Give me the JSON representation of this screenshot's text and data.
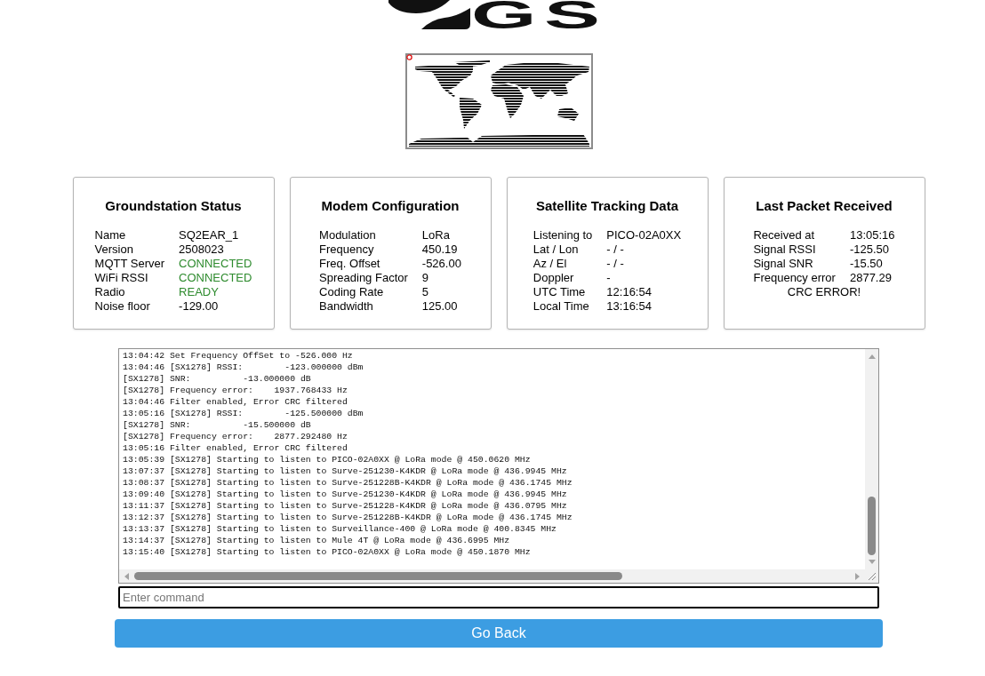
{
  "logo": {
    "text": "GS"
  },
  "cards": [
    {
      "title": "Groundstation Status",
      "rows": [
        {
          "label": "Name",
          "value": "SQ2EAR_1",
          "kind": "plain"
        },
        {
          "label": "Version",
          "value": "2508023",
          "kind": "plain"
        },
        {
          "label": "MQTT Server",
          "value": "CONNECTED",
          "kind": "status"
        },
        {
          "label": "WiFi RSSI",
          "value": "CONNECTED",
          "kind": "status"
        },
        {
          "label": "Radio",
          "value": "READY",
          "kind": "status"
        },
        {
          "label": "Noise floor",
          "value": "-129.00",
          "kind": "plain"
        }
      ]
    },
    {
      "title": "Modem Configuration",
      "rows": [
        {
          "label": "Modulation",
          "value": "LoRa",
          "kind": "plain"
        },
        {
          "label": "Frequency",
          "value": "450.19",
          "kind": "plain"
        },
        {
          "label": "Freq. Offset",
          "value": "-526.00",
          "kind": "plain"
        },
        {
          "label": "Spreading Factor",
          "value": "9",
          "kind": "plain"
        },
        {
          "label": "Coding Rate",
          "value": "5",
          "kind": "plain"
        },
        {
          "label": "Bandwidth",
          "value": "125.00",
          "kind": "plain"
        }
      ]
    },
    {
      "title": "Satellite Tracking Data",
      "rows": [
        {
          "label": "Listening to",
          "value": "PICO-02A0XX",
          "kind": "plain"
        },
        {
          "label": "Lat / Lon",
          "value": "- / -",
          "kind": "plain"
        },
        {
          "label": "Az / El",
          "value": "- / -",
          "kind": "plain"
        },
        {
          "label": "Doppler",
          "value": "-",
          "kind": "plain"
        },
        {
          "label": "UTC Time",
          "value": "12:16:54",
          "kind": "plain"
        },
        {
          "label": "Local Time",
          "value": "13:16:54",
          "kind": "plain"
        }
      ]
    },
    {
      "title": "Last Packet Received",
      "rows": [
        {
          "label": "Received at",
          "value": "13:05:16",
          "kind": "plain"
        },
        {
          "label": "Signal RSSI",
          "value": "-125.50",
          "kind": "plain"
        },
        {
          "label": "Signal SNR",
          "value": "-15.50",
          "kind": "plain"
        },
        {
          "label": "Frequency error",
          "value": "2877.29",
          "kind": "plain"
        }
      ],
      "note": "CRC ERROR!"
    }
  ],
  "console": {
    "lines": [
      "13:04:42 Set Frequency OffSet to -526.000 Hz",
      "13:04:46 [SX1278] RSSI:        -123.000000 dBm",
      "[SX1278] SNR:          -13.000000 dB",
      "[SX1278] Frequency error:    1937.768433 Hz",
      "13:04:46 Filter enabled, Error CRC filtered",
      "13:05:16 [SX1278] RSSI:        -125.500000 dBm",
      "[SX1278] SNR:          -15.500000 dB",
      "[SX1278] Frequency error:    2877.292480 Hz",
      "13:05:16 Filter enabled, Error CRC filtered",
      "13:05:39 [SX1278] Starting to listen to PICO-02A0XX @ LoRa mode @ 450.0620 MHz",
      "13:07:37 [SX1278] Starting to listen to Surve-251230-K4KDR @ LoRa mode @ 436.9945 MHz",
      "13:08:37 [SX1278] Starting to listen to Surve-251228B-K4KDR @ LoRa mode @ 436.1745 MHz",
      "13:09:40 [SX1278] Starting to listen to Surve-251230-K4KDR @ LoRa mode @ 436.9945 MHz",
      "13:11:37 [SX1278] Starting to listen to Surve-251228-K4KDR @ LoRa mode @ 436.0795 MHz",
      "13:12:37 [SX1278] Starting to listen to Surve-251228B-K4KDR @ LoRa mode @ 436.1745 MHz",
      "13:13:37 [SX1278] Starting to listen to Surveillance-400 @ LoRa mode @ 400.8345 MHz",
      "13:14:37 [SX1278] Starting to listen to Mule 4T @ LoRa mode @ 436.6995 MHz",
      "13:15:40 [SX1278] Starting to listen to PICO-02A0XX @ LoRa mode @ 450.1870 MHz"
    ]
  },
  "command": {
    "placeholder": "Enter command"
  },
  "back_button": {
    "label": "Go Back"
  }
}
